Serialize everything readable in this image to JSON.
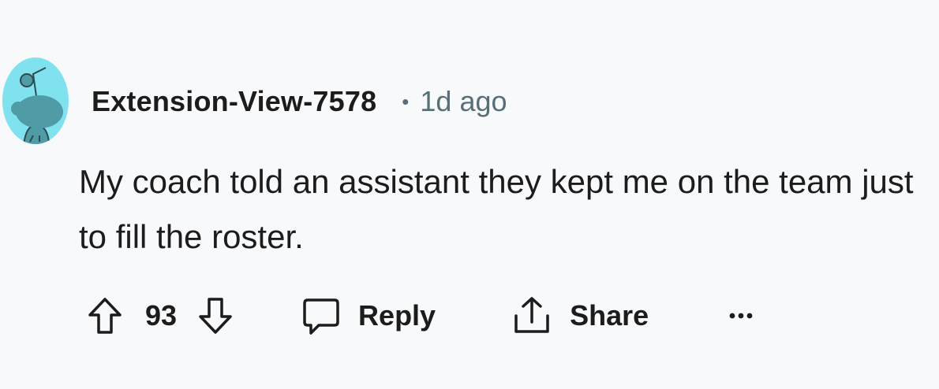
{
  "comment": {
    "avatar_icon": "snoo-avatar-icon",
    "avatar_color": "#7fe2ee",
    "username": "Extension-View-7578",
    "separator": "•",
    "timestamp": "1d ago",
    "body": "My coach told an assistant they kept me on the team just to fill the roster."
  },
  "actions": {
    "upvote_icon": "upvote-arrow-icon",
    "score": "93",
    "downvote_icon": "downvote-arrow-icon",
    "reply_icon": "speech-bubble-icon",
    "reply_label": "Reply",
    "share_icon": "share-icon",
    "share_label": "Share",
    "more_icon": "ellipsis-icon"
  },
  "colors": {
    "background": "#f8f9fb",
    "text": "#1c1c1c",
    "muted": "#576f76"
  }
}
